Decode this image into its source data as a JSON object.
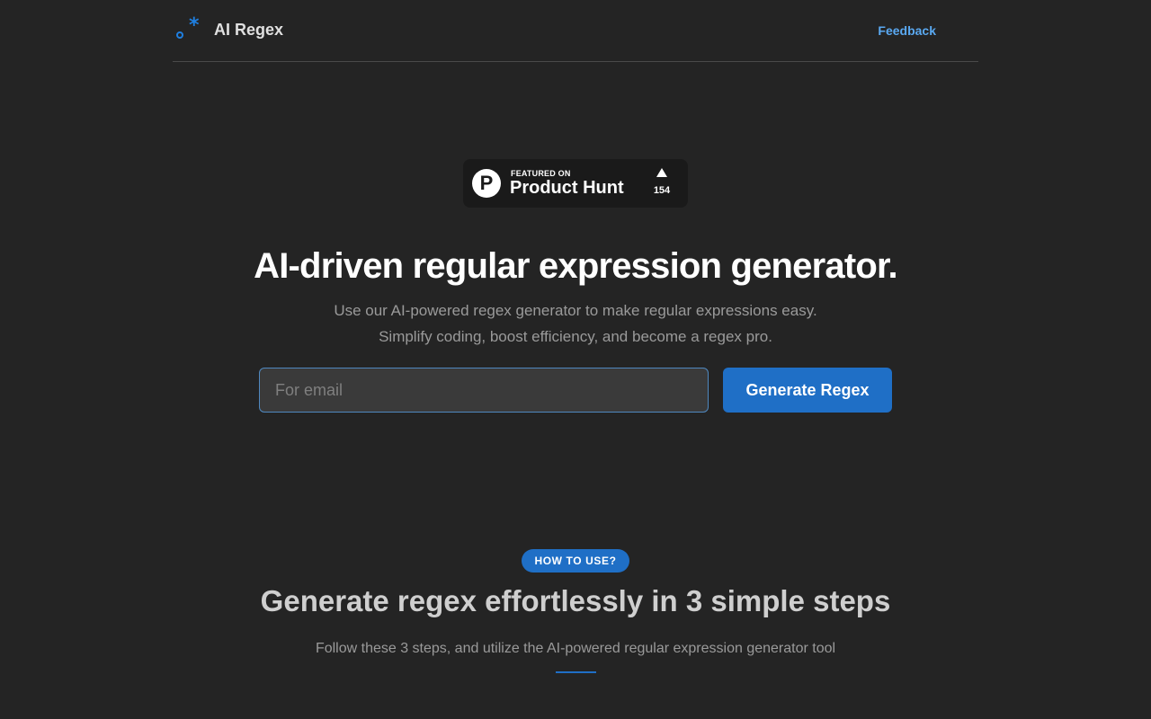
{
  "header": {
    "brand": "AI Regex",
    "feedback_link": "Feedback"
  },
  "product_hunt": {
    "featured_label": "FEATURED ON",
    "name": "Product Hunt",
    "logo_letter": "P",
    "upvotes": "154"
  },
  "hero": {
    "title": "AI-driven regular expression generator.",
    "subtitle_line1": "Use our AI-powered regex generator to make regular expressions easy.",
    "subtitle_line2": "Simplify coding, boost efficiency, and become a regex pro.",
    "input_placeholder": "For email",
    "input_value": "",
    "button_label": "Generate Regex"
  },
  "how_to": {
    "badge": "HOW TO USE?",
    "title": "Generate regex effortlessly in 3 simple steps",
    "subtitle": "Follow these 3 steps, and utilize the AI-powered regular expression generator tool"
  },
  "colors": {
    "background": "#242424",
    "accent": "#1f6fc6",
    "link": "#5aa9f2"
  }
}
